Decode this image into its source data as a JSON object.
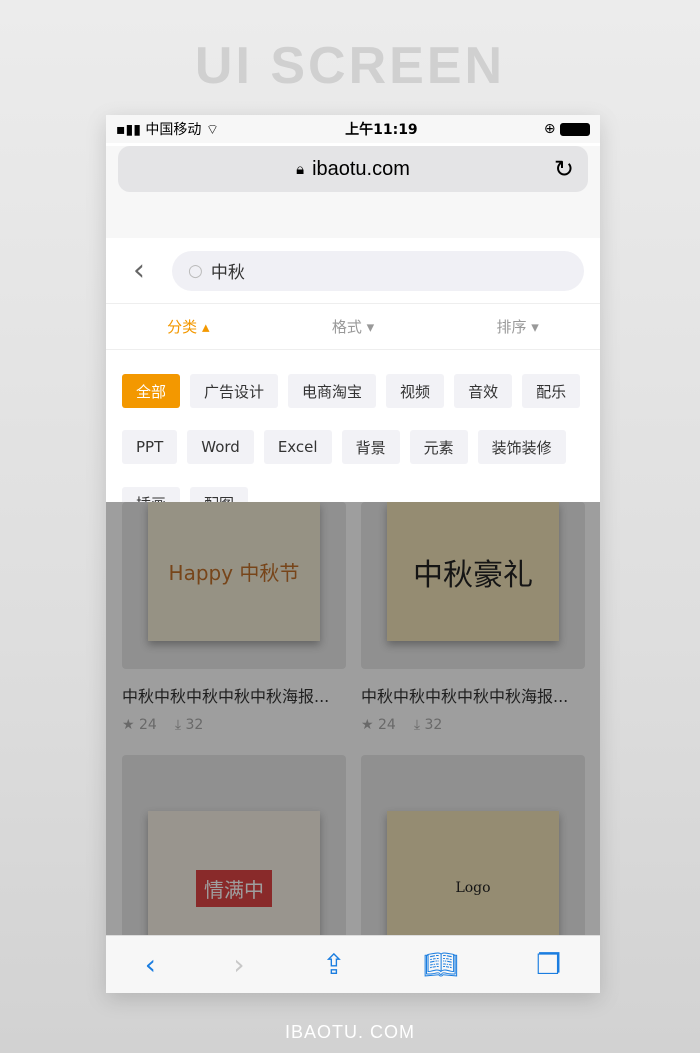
{
  "page": {
    "title": "UI SCREEN",
    "footer": "IBAOTU. COM"
  },
  "status": {
    "carrier": "中国移动",
    "time": "上午11:19"
  },
  "browser": {
    "url": "ibaotu.com"
  },
  "search": {
    "value": "中秋"
  },
  "filters": [
    {
      "label": "分类 ▴",
      "active": true
    },
    {
      "label": "格式 ▾"
    },
    {
      "label": "排序 ▾"
    }
  ],
  "tags": [
    "全部",
    "广告设计",
    "电商淘宝",
    "视频",
    "音效",
    "配乐",
    "PPT",
    "Word",
    "Excel",
    "背景",
    "元素",
    "装饰装修",
    "插画",
    "配图"
  ],
  "colors": {
    "accent": "#f39800",
    "link": "#1a7de0"
  },
  "cards": [
    {
      "title": "中秋中秋中秋中秋中秋海报...",
      "stars": "24",
      "downloads": "32",
      "poster": "Happy 中秋节"
    },
    {
      "title": "中秋中秋中秋中秋中秋海报...",
      "stars": "24",
      "downloads": "32",
      "poster": "中秋豪礼"
    },
    {
      "poster": "情满中"
    },
    {
      "poster": "Logo"
    }
  ]
}
